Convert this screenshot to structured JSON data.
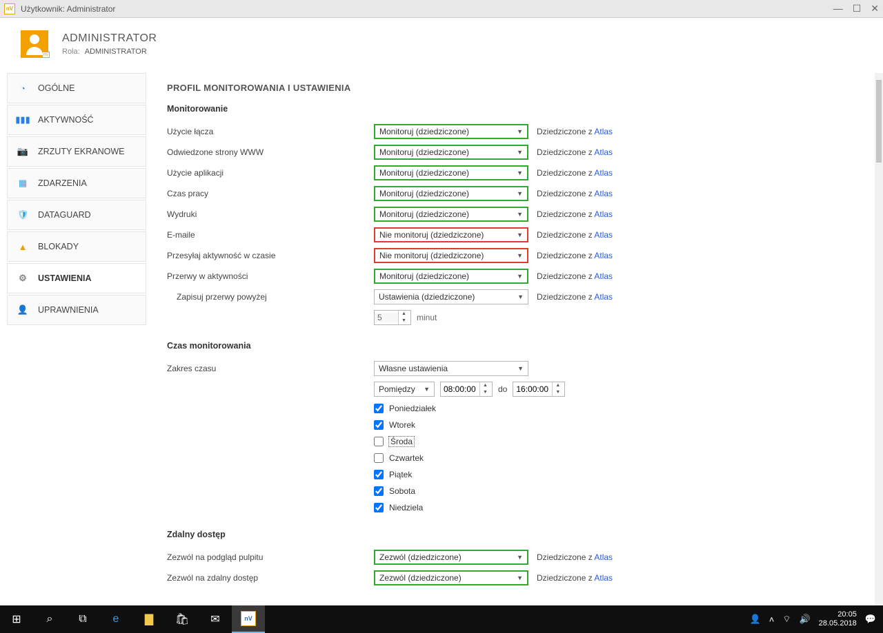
{
  "window": {
    "title": "Użytkownik: Administrator"
  },
  "header": {
    "name": "ADMINISTRATOR",
    "role_label": "Rola:",
    "role": "ADMINISTRATOR"
  },
  "sidebar": {
    "items": [
      {
        "label": "OGÓLNE",
        "icon": "◔",
        "color": "#2ca0d4"
      },
      {
        "label": "AKTYWNOŚĆ",
        "icon": "▮▮▮",
        "color": "#2a7de1"
      },
      {
        "label": "ZRZUTY EKRANOWE",
        "icon": "📷",
        "color": "#2aa7e1"
      },
      {
        "label": "ZDARZENIA",
        "icon": "▦",
        "color": "#2aa7e1"
      },
      {
        "label": "DATAGUARD",
        "icon": "🛡",
        "color": "#2aa7e1"
      },
      {
        "label": "BLOKADY",
        "icon": "▲",
        "color": "#e6a400"
      },
      {
        "label": "USTAWIENIA",
        "icon": "⚙",
        "color": "#888"
      },
      {
        "label": "UPRAWNIENIA",
        "icon": "👤",
        "color": "#2aa7e1"
      }
    ],
    "active": 6
  },
  "main": {
    "title": "PROFIL MONITOROWANIA I USTAWIENIA",
    "inherit_prefix": "Dziedziczone z ",
    "inherit_source": "Atlas",
    "monitoring": {
      "heading": "Monitorowanie",
      "rows": [
        {
          "label": "Użycie łącza",
          "value": "Monitoruj (dziedziczone)",
          "variant": "green"
        },
        {
          "label": "Odwiedzone strony WWW",
          "value": "Monitoruj (dziedziczone)",
          "variant": "green"
        },
        {
          "label": "Użycie aplikacji",
          "value": "Monitoruj (dziedziczone)",
          "variant": "green"
        },
        {
          "label": "Czas pracy",
          "value": "Monitoruj (dziedziczone)",
          "variant": "green"
        },
        {
          "label": "Wydruki",
          "value": "Monitoruj (dziedziczone)",
          "variant": "green"
        },
        {
          "label": "E-maile",
          "value": "Nie monitoruj (dziedziczone)",
          "variant": "red"
        },
        {
          "label": "Przesyłaj aktywność w czasie",
          "value": "Nie monitoruj (dziedziczone)",
          "variant": "red"
        },
        {
          "label": "Przerwy w aktywności",
          "value": "Monitoruj (dziedziczone)",
          "variant": "green"
        }
      ],
      "breaks_save_label": "Zapisuj przerwy powyżej",
      "breaks_save_value": "Ustawienia (dziedziczone)",
      "breaks_minutes": "5",
      "minutes_label": "minut"
    },
    "timing": {
      "heading": "Czas monitorowania",
      "range_label": "Zakres czasu",
      "range_value": "Własne ustawienia",
      "between_label": "Pomiędzy",
      "from": "08:00:00",
      "to_label": "do",
      "to": "16:00:00",
      "days": [
        {
          "label": "Poniedziałek",
          "checked": true
        },
        {
          "label": "Wtorek",
          "checked": true
        },
        {
          "label": "Środa",
          "checked": false,
          "focus": true
        },
        {
          "label": "Czwartek",
          "checked": false
        },
        {
          "label": "Piątek",
          "checked": true
        },
        {
          "label": "Sobota",
          "checked": true
        },
        {
          "label": "Niedziela",
          "checked": true
        }
      ]
    },
    "remote": {
      "heading": "Zdalny dostęp",
      "rows": [
        {
          "label": "Zezwól na podgląd pulpitu",
          "value": "Zezwól (dziedziczone)",
          "variant": "green"
        },
        {
          "label": "Zezwól na zdalny dostęp",
          "value": "Zezwól (dziedziczone)",
          "variant": "green"
        }
      ]
    }
  },
  "taskbar": {
    "time": "20:05",
    "date": "28.05.2018"
  }
}
